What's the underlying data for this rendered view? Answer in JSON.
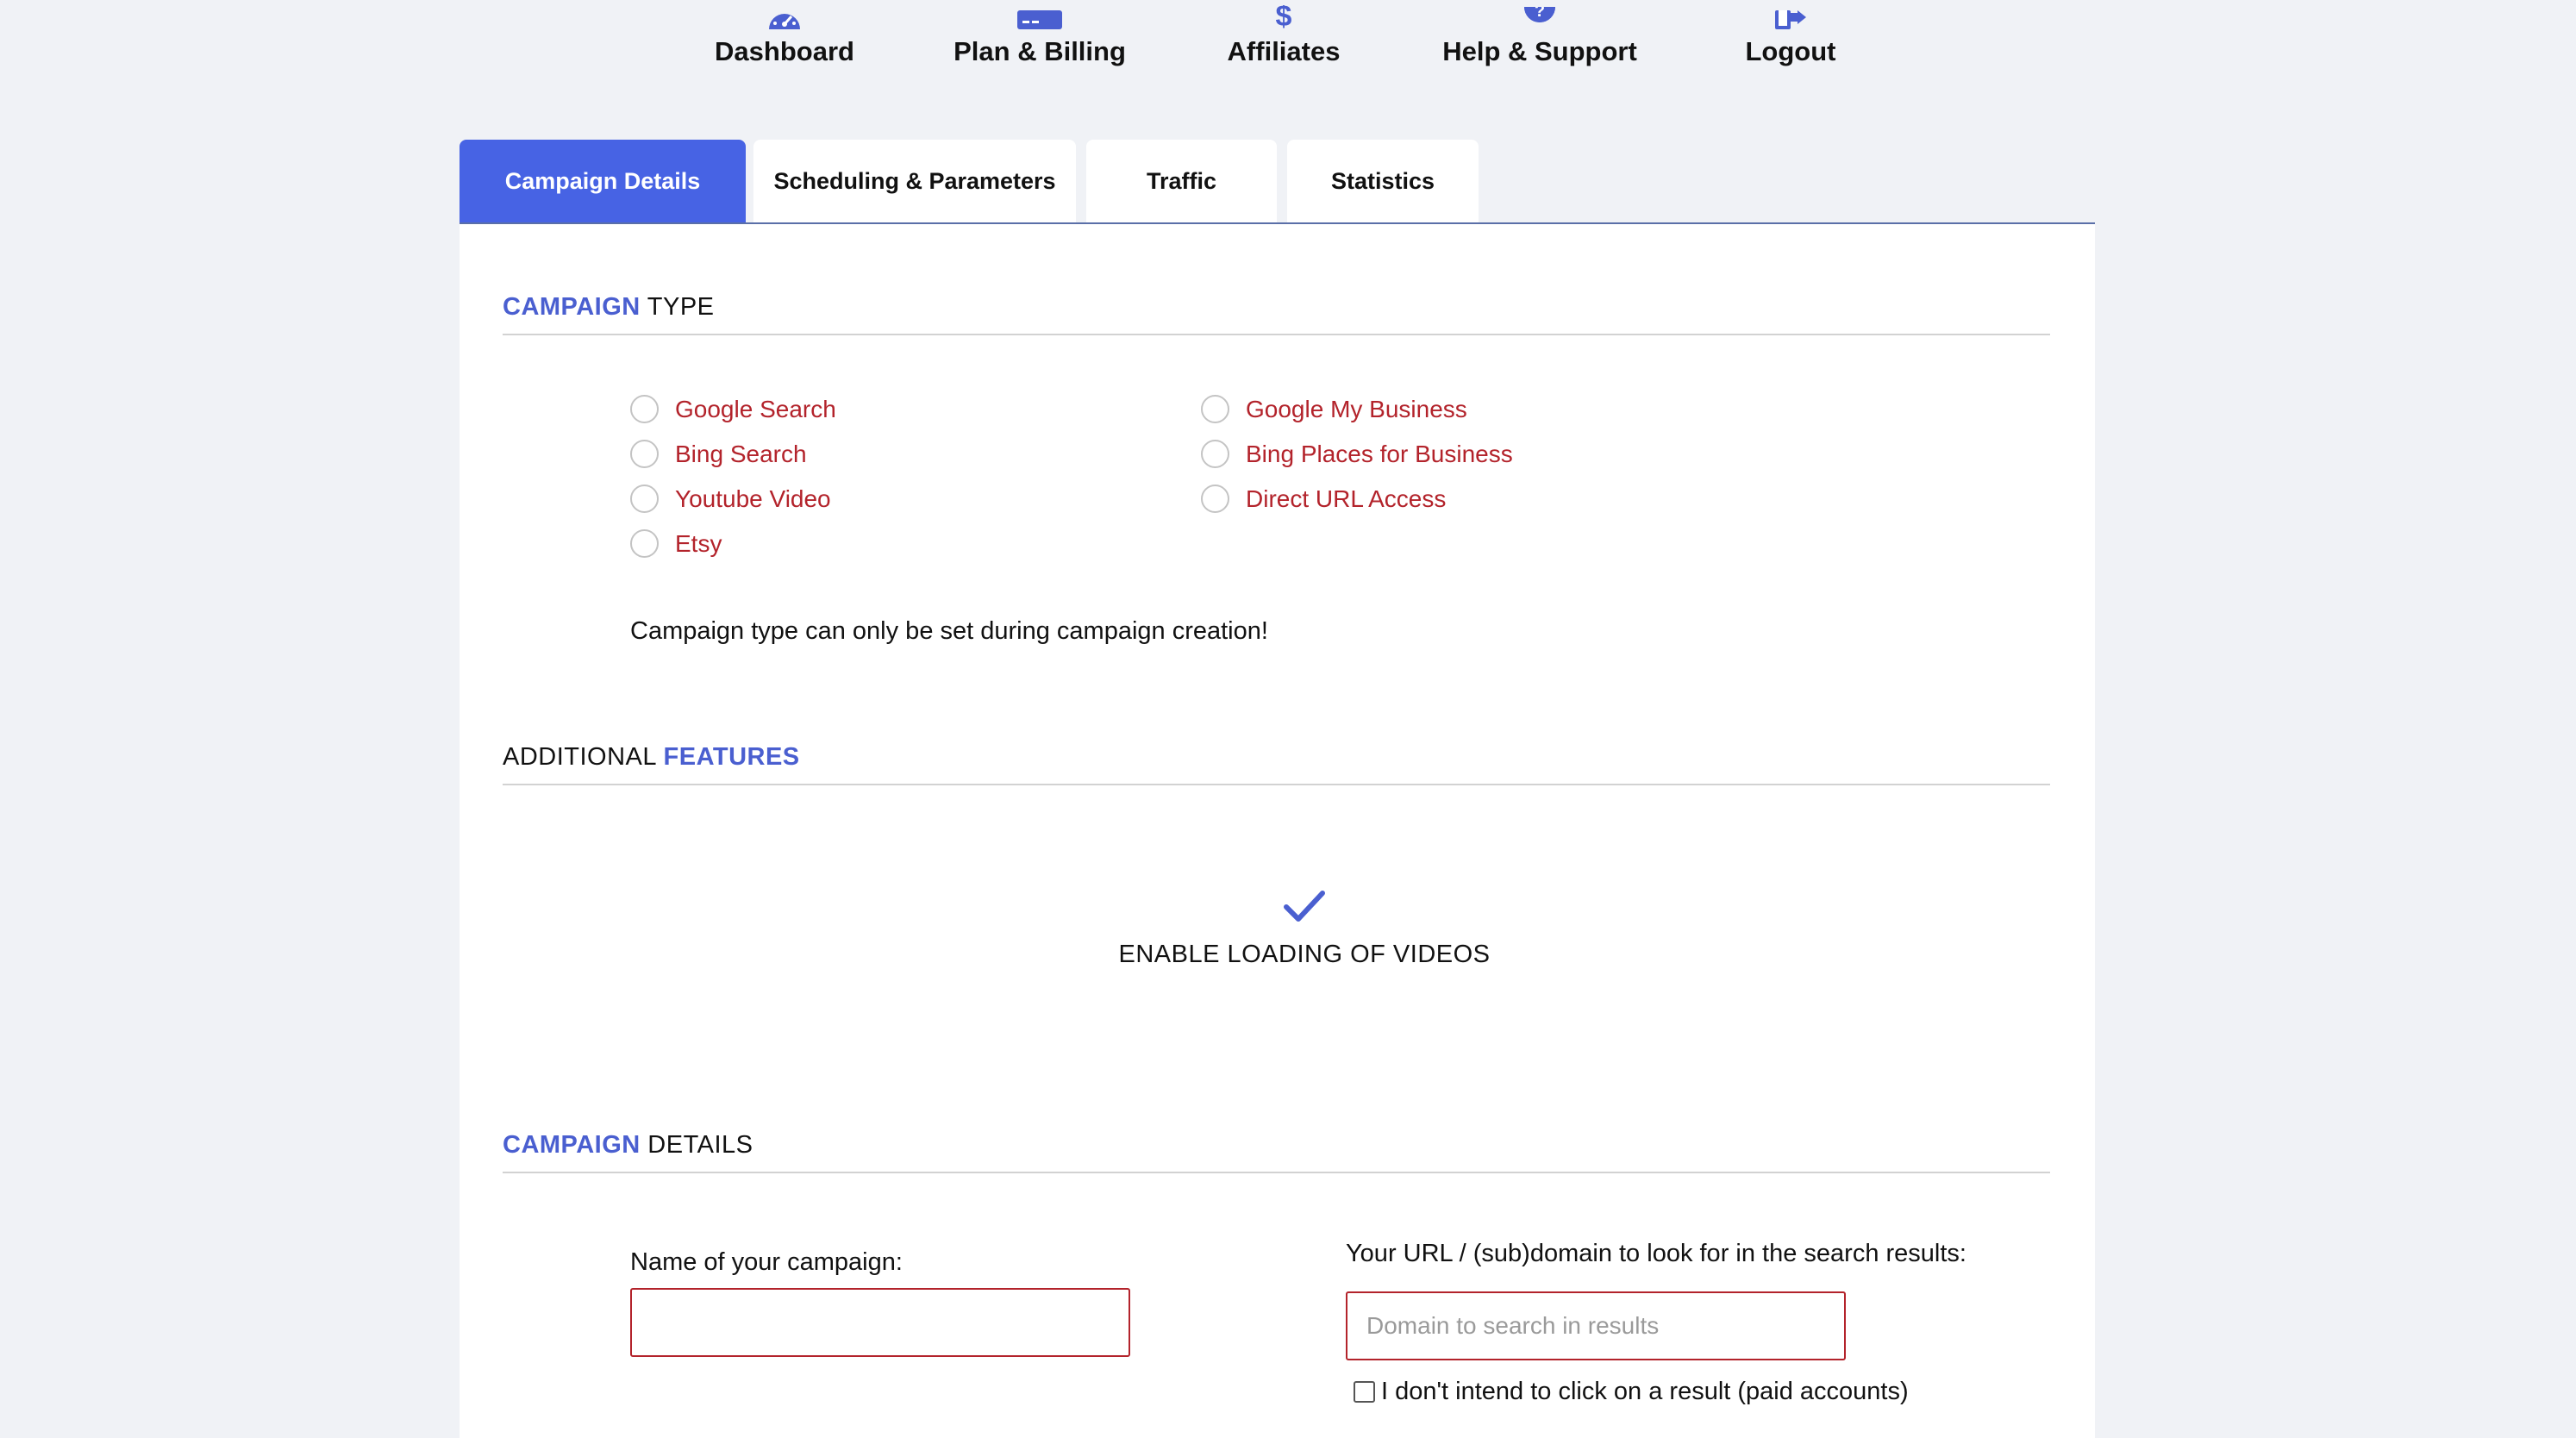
{
  "nav": {
    "items": [
      {
        "label": "Dashboard",
        "icon": "gauge-icon"
      },
      {
        "label": "Plan & Billing",
        "icon": "credit-card-icon"
      },
      {
        "label": "Affiliates",
        "icon": "dollar-icon"
      },
      {
        "label": "Help & Support",
        "icon": "question-circle-icon"
      },
      {
        "label": "Logout",
        "icon": "logout-icon"
      }
    ]
  },
  "tabs": [
    {
      "label": "Campaign Details",
      "active": true
    },
    {
      "label": "Scheduling & Parameters",
      "active": false
    },
    {
      "label": "Traffic",
      "active": false
    },
    {
      "label": "Statistics",
      "active": false
    }
  ],
  "campaign_type": {
    "heading_accent": "CAMPAIGN",
    "heading_rest": " TYPE",
    "options_left": [
      "Google Search",
      "Bing Search",
      "Youtube Video",
      "Etsy"
    ],
    "options_right": [
      "Google My Business",
      "Bing Places for Business",
      "Direct URL Access"
    ],
    "note": "Campaign type can only be set during campaign creation!"
  },
  "additional_features": {
    "heading_rest": "ADDITIONAL ",
    "heading_accent": "FEATURES",
    "feature_label": "ENABLE LOADING OF VIDEOS",
    "feature_enabled": true
  },
  "campaign_details": {
    "heading_accent": "CAMPAIGN",
    "heading_rest": " DETAILS",
    "name_label": "Name of your campaign:",
    "name_value": "",
    "url_label": "Your URL / (sub)domain to look for in the search results:",
    "url_placeholder": "Domain to search in results",
    "no_click_label": "I don't intend to click on a result (paid accounts)",
    "no_click_checked": false
  },
  "colors": {
    "accent": "#4763e4",
    "heading_accent": "#4a5fd0",
    "option_text": "#b3232b",
    "page_bg": "#f0f2f6"
  }
}
